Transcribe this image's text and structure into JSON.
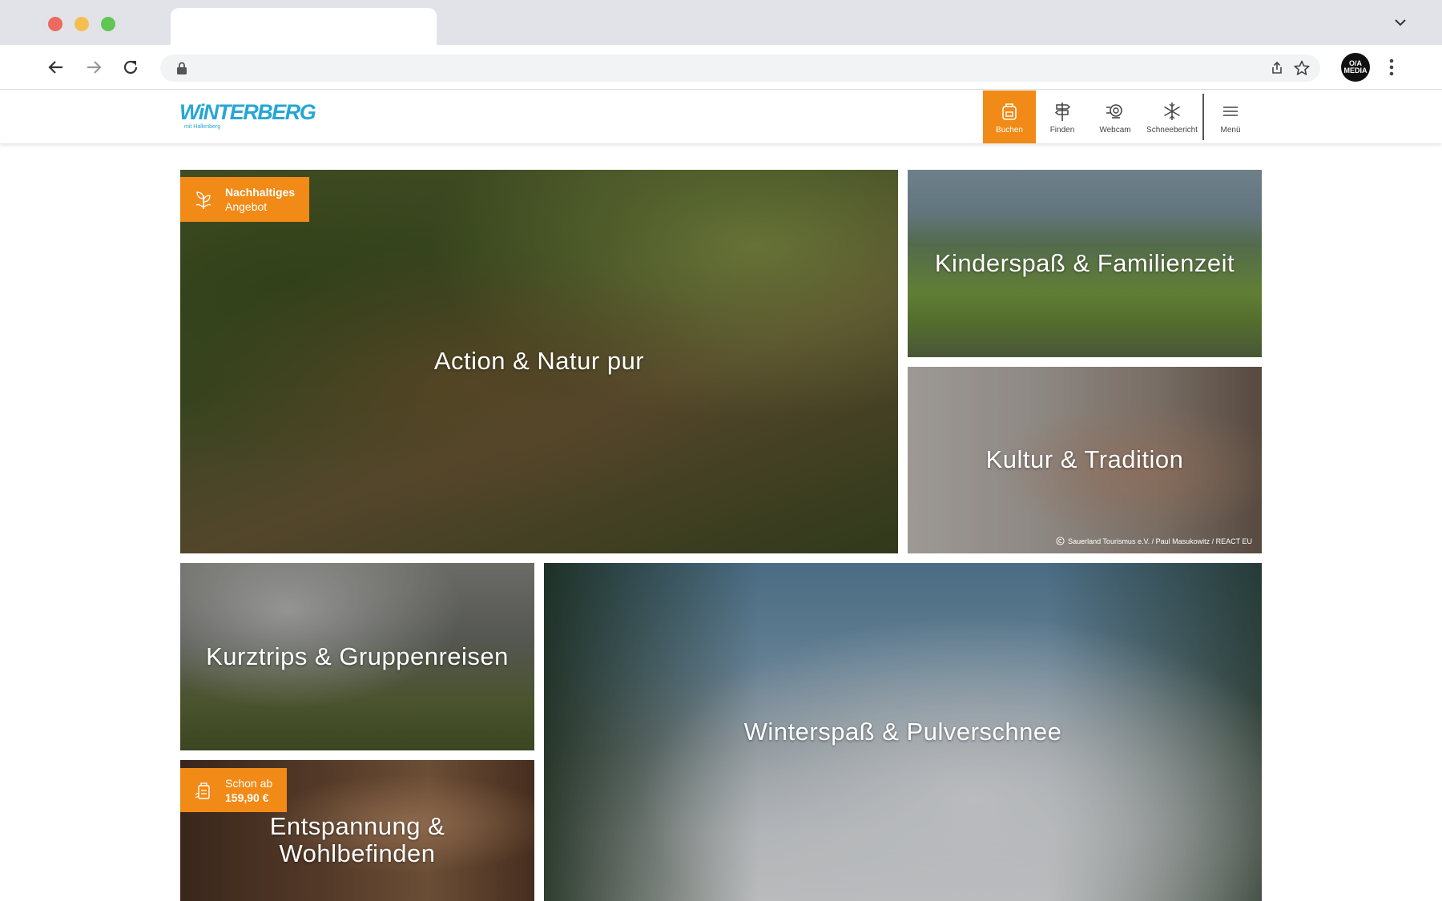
{
  "site": {
    "logo_text": "WiNTERBERG",
    "logo_sub": "mit Hallenberg"
  },
  "browser": {
    "profile_label": "O/A MEDIA"
  },
  "nav": {
    "items": [
      {
        "label": "Buchen",
        "icon": "backpack-icon",
        "active": true
      },
      {
        "label": "Finden",
        "icon": "signpost-icon",
        "active": false
      },
      {
        "label": "Webcam",
        "icon": "webcam-icon",
        "active": false
      },
      {
        "label": "Schneebericht",
        "icon": "snowflake-icon",
        "active": false
      },
      {
        "label": "Menü",
        "icon": "hamburger-menu-icon",
        "active": false
      }
    ]
  },
  "colors": {
    "accent": "#f18a16",
    "logo": "#27a6d6"
  },
  "tiles": {
    "action": {
      "title": "Action & Natur pur",
      "badge_line1": "Nachhaltiges",
      "badge_line2": "Angebot"
    },
    "kinder": {
      "title": "Kinderspaß & Familienzeit"
    },
    "kultur": {
      "title": "Kultur & Tradition",
      "credit": "Sauerland Tourismus e.V. / Paul Masukowitz / REACT EU"
    },
    "kurz": {
      "title": "Kurztrips & Gruppenreisen"
    },
    "winter": {
      "title": "Winterspaß & Pulverschnee"
    },
    "entsp": {
      "title_line1": "Entspannung &",
      "title_line2": "Wohlbefinden",
      "badge_line1": "Schon ab",
      "badge_line2": "159,90 €"
    }
  }
}
